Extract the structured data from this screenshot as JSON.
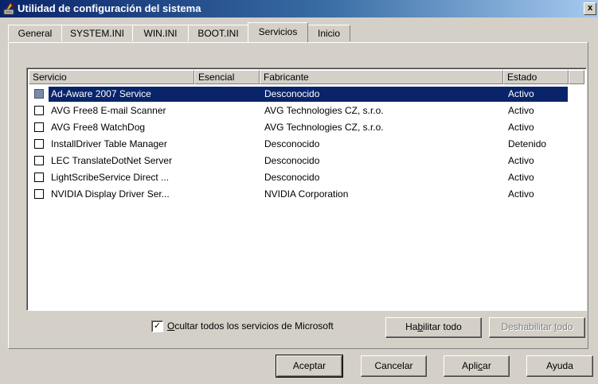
{
  "window": {
    "title": "Utilidad de configuración del sistema",
    "close_label": "x",
    "title_bar_colors": [
      "#0a246a",
      "#a6caf0"
    ]
  },
  "tabs": [
    {
      "label": "General",
      "active": false
    },
    {
      "label": "SYSTEM.INI",
      "active": false
    },
    {
      "label": "WIN.INI",
      "active": false
    },
    {
      "label": "BOOT.INI",
      "active": false
    },
    {
      "label": "Servicios",
      "active": true
    },
    {
      "label": "Inicio",
      "active": false
    }
  ],
  "table": {
    "columns": [
      "Servicio",
      "Esencial",
      "Fabricante",
      "Estado"
    ],
    "rows": [
      {
        "servicio": "Ad-Aware 2007 Service",
        "esencial": "",
        "fabricante": "Desconocido",
        "estado": "Activo",
        "checked": false,
        "selected": true
      },
      {
        "servicio": "AVG Free8 E-mail Scanner",
        "esencial": "",
        "fabricante": "AVG Technologies CZ, s.r.o.",
        "estado": "Activo",
        "checked": false,
        "selected": false
      },
      {
        "servicio": "AVG Free8 WatchDog",
        "esencial": "",
        "fabricante": "AVG Technologies CZ, s.r.o.",
        "estado": "Activo",
        "checked": false,
        "selected": false
      },
      {
        "servicio": "InstallDriver Table Manager",
        "esencial": "",
        "fabricante": "Desconocido",
        "estado": "Detenido",
        "checked": false,
        "selected": false
      },
      {
        "servicio": "LEC TranslateDotNet Server",
        "esencial": "",
        "fabricante": "Desconocido",
        "estado": "Activo",
        "checked": false,
        "selected": false
      },
      {
        "servicio": "LightScribeService Direct ...",
        "esencial": "",
        "fabricante": "Desconocido",
        "estado": "Activo",
        "checked": false,
        "selected": false
      },
      {
        "servicio": "NVIDIA Display Driver Ser...",
        "esencial": "",
        "fabricante": "NVIDIA Corporation",
        "estado": "Activo",
        "checked": false,
        "selected": false
      }
    ]
  },
  "hide_ms": {
    "label": "Ocultar todos los servicios de Microsoft",
    "mnemonic": "O",
    "rest": "cultar todos los servicios de Microsoft",
    "checked": true,
    "check_glyph": "✓"
  },
  "buttons": {
    "enable_all": {
      "pre": "Ha",
      "mn": "b",
      "post": "ilitar todo"
    },
    "disable_all": {
      "pre": "Deshabilitar ",
      "mn": "t",
      "post": "odo"
    },
    "aceptar": "Aceptar",
    "cancelar": "Cancelar",
    "aplicar": {
      "pre": "Apli",
      "mn": "c",
      "post": "ar"
    },
    "ayuda": "Ayuda"
  }
}
